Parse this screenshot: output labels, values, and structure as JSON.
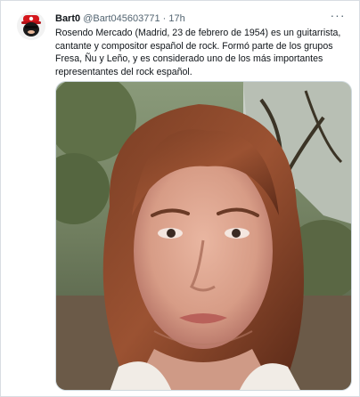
{
  "tweet": {
    "display_name": "Bart0",
    "handle": "@Bart045603771",
    "separator": "·",
    "timestamp": "17h",
    "more_label": "···",
    "text": "Rosendo Mercado (Madrid, 23 de febrero de 1954) es un guitarrista, cantante y compositor español de rock. Formó parte de los grupos Fresa, Ñu y Leño, y es considerado uno de los más importantes representantes del rock español.",
    "avatar_icon": "cartoon-avatar-icon",
    "media_type": "video-thumbnail"
  },
  "colors": {
    "text": "#0f1419",
    "secondary": "#536471",
    "border": "#cfd9de"
  }
}
